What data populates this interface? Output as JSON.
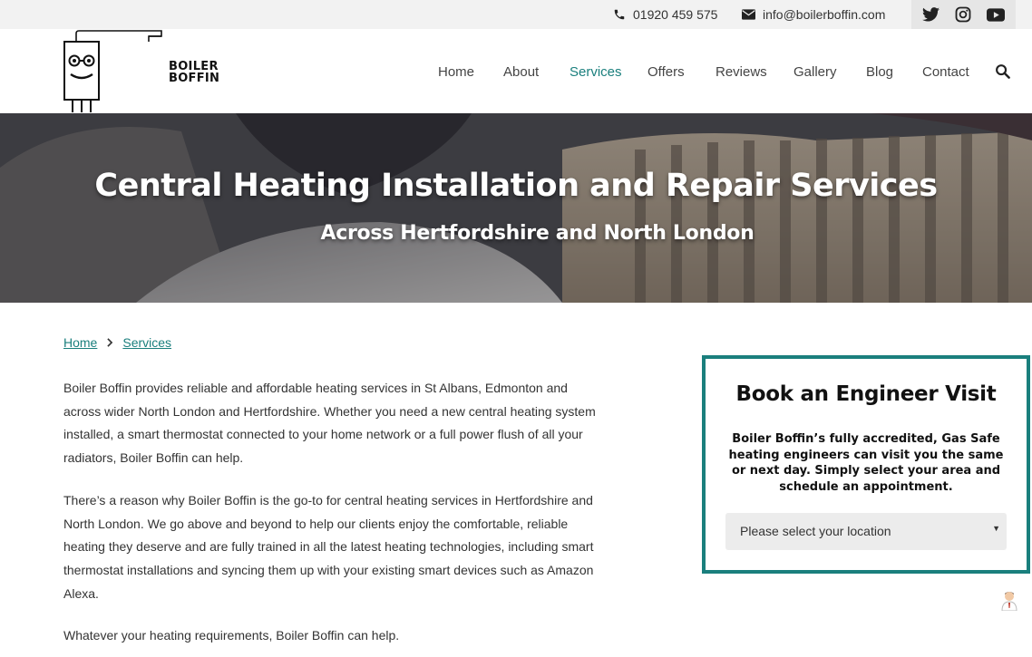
{
  "topbar": {
    "phone": "01920 459 575",
    "email": "info@boilerboffin.com",
    "social": [
      "twitter-icon",
      "instagram-icon",
      "youtube-icon"
    ]
  },
  "logo": {
    "line1": "BOILER",
    "line2": "BOFFIN"
  },
  "nav": {
    "items": [
      {
        "label": "Home"
      },
      {
        "label": "About"
      },
      {
        "label": "Services"
      },
      {
        "label": "Offers"
      },
      {
        "label": "Reviews"
      },
      {
        "label": "Gallery"
      },
      {
        "label": "Blog"
      },
      {
        "label": "Contact"
      }
    ],
    "active": "Services"
  },
  "hero": {
    "title": "Central Heating Installation and Repair Services",
    "subtitle": "Across Hertfordshire and North London"
  },
  "breadcrumb": {
    "home": "Home",
    "current": "Services"
  },
  "content": {
    "p1": "Boiler Boffin provides reliable and affordable heating services in St Albans, Edmonton and across wider North London and Hertfordshire. Whether you need a new central heating system installed, a smart thermostat connected to your home network or a full power flush of all your radiators, Boiler Boffin can help.",
    "p2": "There’s a reason why Boiler Boffin is the go-to for central heating services in Hertfordshire and North London. We go above and beyond to help our clients enjoy the comfortable, reliable heating they deserve and are fully trained in all the latest heating technologies, including smart thermostat installations and syncing them up with your existing smart devices such as Amazon Alexa.",
    "p3": "Whatever your heating requirements, Boiler Boffin can help."
  },
  "booking": {
    "title": "Book an Engineer Visit",
    "text": "Boiler Boffin’s fully accredited, Gas Safe heating engineers can visit you the same or next day. Simply select your area and schedule an appointment.",
    "select_value": "Please select your location"
  },
  "colors": {
    "accent": "#1a7f7d",
    "topbar": "#f2f2f2"
  }
}
